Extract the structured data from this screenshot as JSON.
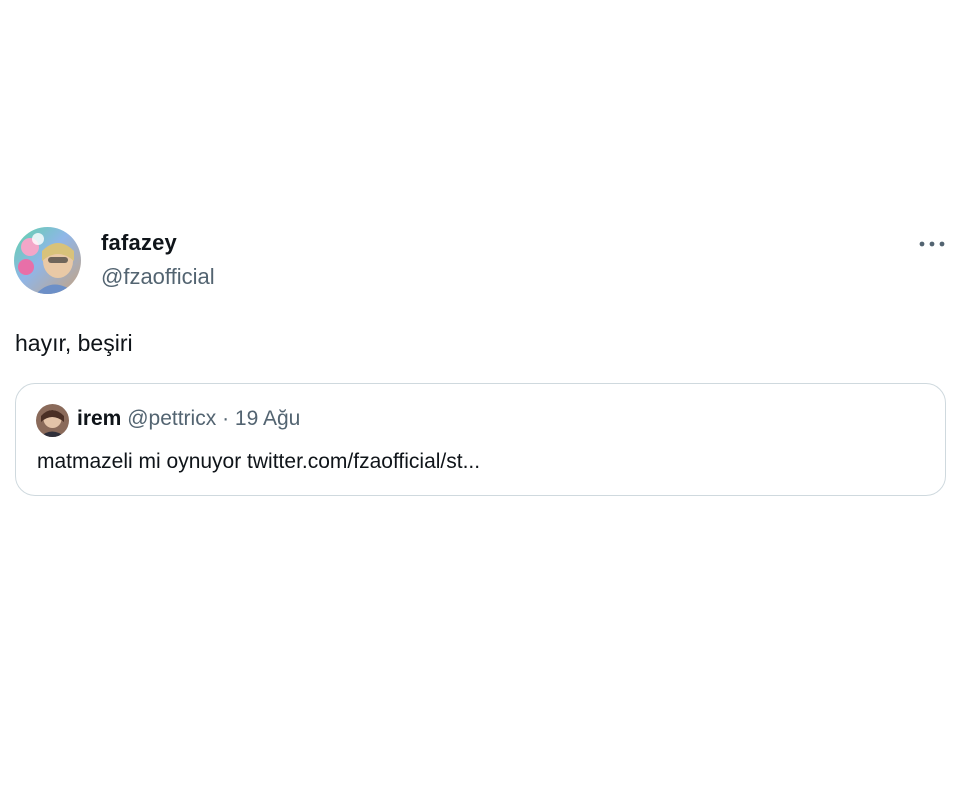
{
  "tweet": {
    "author": {
      "display_name": "fafazey",
      "handle": "@fzaofficial",
      "avatar_icon": "profile-photo"
    },
    "text": "hayır, beşiri",
    "more_icon": "more-horizontal-icon"
  },
  "quoted_tweet": {
    "author": {
      "display_name": "irem",
      "handle": "@pettricx",
      "avatar_icon": "profile-photo"
    },
    "separator": "·",
    "date": "19 Ağu",
    "text": "matmazeli mi oynuyor twitter.com/fzaofficial/st..."
  },
  "colors": {
    "text_primary": "#0f1419",
    "text_secondary": "#536471",
    "border": "#cfd9de",
    "background": "#ffffff"
  }
}
